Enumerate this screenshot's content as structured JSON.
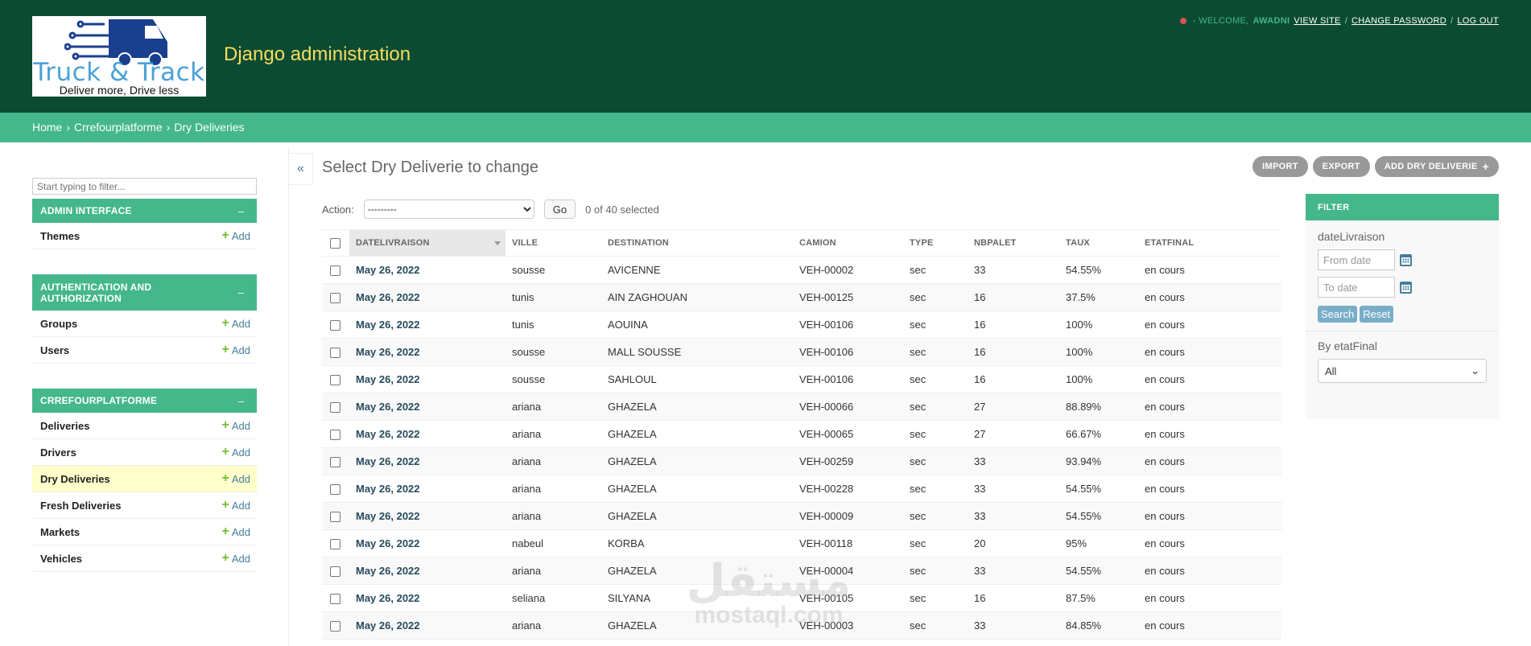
{
  "header": {
    "logo": {
      "brand": "Truck & Track",
      "tagline": "Deliver more, Drive less"
    },
    "site_name": "Django administration",
    "user_tools": {
      "welcome": "- WELCOME,",
      "username": "AWADNI",
      "view_site": "VIEW SITE",
      "change_password": "CHANGE PASSWORD",
      "logout": "LOG OUT",
      "sep": "/"
    }
  },
  "breadcrumbs": {
    "home": "Home",
    "app": "Crrefourplatforme",
    "current": "Dry Deliveries",
    "sep": "›"
  },
  "sidebar": {
    "filter_placeholder": "Start typing to filter...",
    "toggle": "–",
    "add_label": "Add",
    "modules": [
      {
        "caption": "ADMIN INTERFACE",
        "items": [
          "Themes"
        ]
      },
      {
        "caption": "AUTHENTICATION AND AUTHORIZATION",
        "items": [
          "Groups",
          "Users"
        ]
      },
      {
        "caption": "CRREFOURPLATFORME",
        "items": [
          "Deliveries",
          "Drivers",
          "Dry Deliveries",
          "Fresh Deliveries",
          "Markets",
          "Vehicles"
        ],
        "active": "Dry Deliveries"
      }
    ]
  },
  "content": {
    "collapse": "«",
    "title": "Select Dry Deliverie to change",
    "object_tools": {
      "import": "IMPORT",
      "export": "EXPORT",
      "add": "ADD DRY DELIVERIE",
      "add_icon": "+"
    },
    "actions": {
      "label": "Action:",
      "selected_option": "---------",
      "go": "Go",
      "count": "0 of 40 selected"
    },
    "table": {
      "columns": [
        "DATELIVRAISON",
        "VILLE",
        "DESTINATION",
        "CAMION",
        "TYPE",
        "NBPALET",
        "TAUX",
        "ETATFINAL"
      ],
      "rows": [
        [
          "May 26, 2022",
          "sousse",
          "AVICENNE",
          "VEH-00002",
          "sec",
          "33",
          "54.55%",
          "en cours"
        ],
        [
          "May 26, 2022",
          "tunis",
          "AIN ZAGHOUAN",
          "VEH-00125",
          "sec",
          "16",
          "37.5%",
          "en cours"
        ],
        [
          "May 26, 2022",
          "tunis",
          "AOUINA",
          "VEH-00106",
          "sec",
          "16",
          "100%",
          "en cours"
        ],
        [
          "May 26, 2022",
          "sousse",
          "MALL SOUSSE",
          "VEH-00106",
          "sec",
          "16",
          "100%",
          "en cours"
        ],
        [
          "May 26, 2022",
          "sousse",
          "SAHLOUL",
          "VEH-00106",
          "sec",
          "16",
          "100%",
          "en cours"
        ],
        [
          "May 26, 2022",
          "ariana",
          "GHAZELA",
          "VEH-00066",
          "sec",
          "27",
          "88.89%",
          "en cours"
        ],
        [
          "May 26, 2022",
          "ariana",
          "GHAZELA",
          "VEH-00065",
          "sec",
          "27",
          "66.67%",
          "en cours"
        ],
        [
          "May 26, 2022",
          "ariana",
          "GHAZELA",
          "VEH-00259",
          "sec",
          "33",
          "93.94%",
          "en cours"
        ],
        [
          "May 26, 2022",
          "ariana",
          "GHAZELA",
          "VEH-00228",
          "sec",
          "33",
          "54.55%",
          "en cours"
        ],
        [
          "May 26, 2022",
          "ariana",
          "GHAZELA",
          "VEH-00009",
          "sec",
          "33",
          "54.55%",
          "en cours"
        ],
        [
          "May 26, 2022",
          "nabeul",
          "KORBA",
          "VEH-00118",
          "sec",
          "20",
          "95%",
          "en cours"
        ],
        [
          "May 26, 2022",
          "ariana",
          "GHAZELA",
          "VEH-00004",
          "sec",
          "33",
          "54.55%",
          "en cours"
        ],
        [
          "May 26, 2022",
          "seliana",
          "SILYANA",
          "VEH-00105",
          "sec",
          "16",
          "87.5%",
          "en cours"
        ],
        [
          "May 26, 2022",
          "ariana",
          "GHAZELA",
          "VEH-00003",
          "sec",
          "33",
          "84.85%",
          "en cours"
        ]
      ]
    }
  },
  "filter": {
    "title": "FILTER",
    "date_label": "dateLivraison",
    "from_placeholder": "From date",
    "to_placeholder": "To date",
    "search": "Search",
    "reset": "Reset",
    "etat_label": "By etatFinal",
    "etat_selected": "All"
  },
  "watermark": {
    "arabic": "مستقل",
    "latin": "mostaql.com"
  },
  "colors": {
    "header": "#0c4b33",
    "accent": "#44b78b",
    "site_name": "#f5dd5d",
    "active_row": "#ffffcc"
  }
}
